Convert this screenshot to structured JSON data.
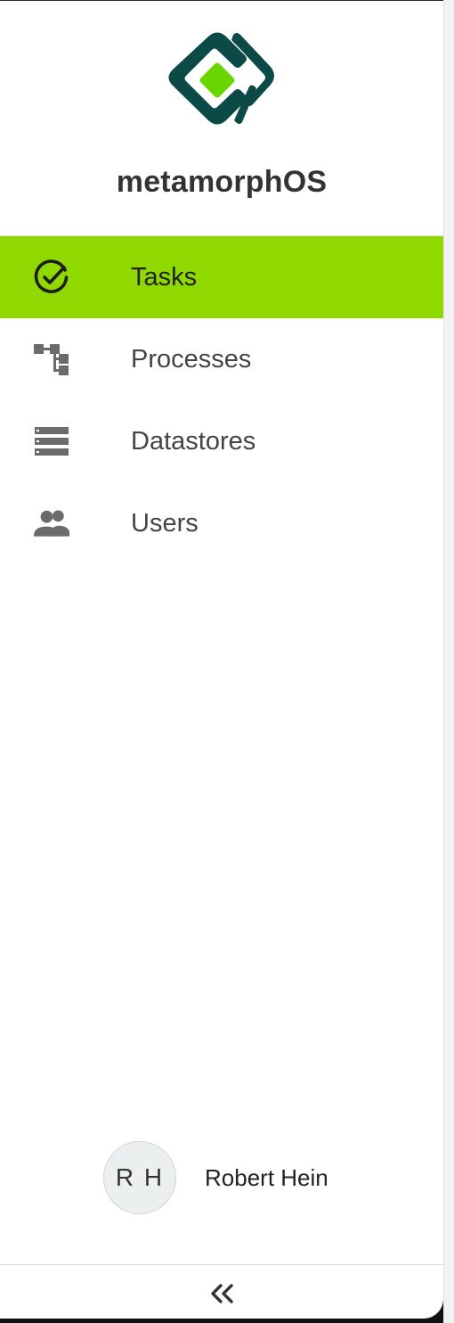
{
  "app": {
    "name": "metamorphOS",
    "logo_icon": "metamorphos-logo-icon",
    "brand_colors": {
      "logo_dark": "#0c4a47",
      "logo_green": "#6ad600",
      "active_nav": "#8fd800"
    }
  },
  "nav": {
    "items": [
      {
        "label": "Tasks",
        "icon": "check-circle-icon",
        "active": true
      },
      {
        "label": "Processes",
        "icon": "process-tree-icon",
        "active": false
      },
      {
        "label": "Datastores",
        "icon": "datastore-list-icon",
        "active": false
      },
      {
        "label": "Users",
        "icon": "users-icon",
        "active": false
      }
    ]
  },
  "user": {
    "initials": "R H",
    "name": "Robert Hein"
  },
  "footer": {
    "collapse_icon": "double-chevron-left-icon"
  }
}
